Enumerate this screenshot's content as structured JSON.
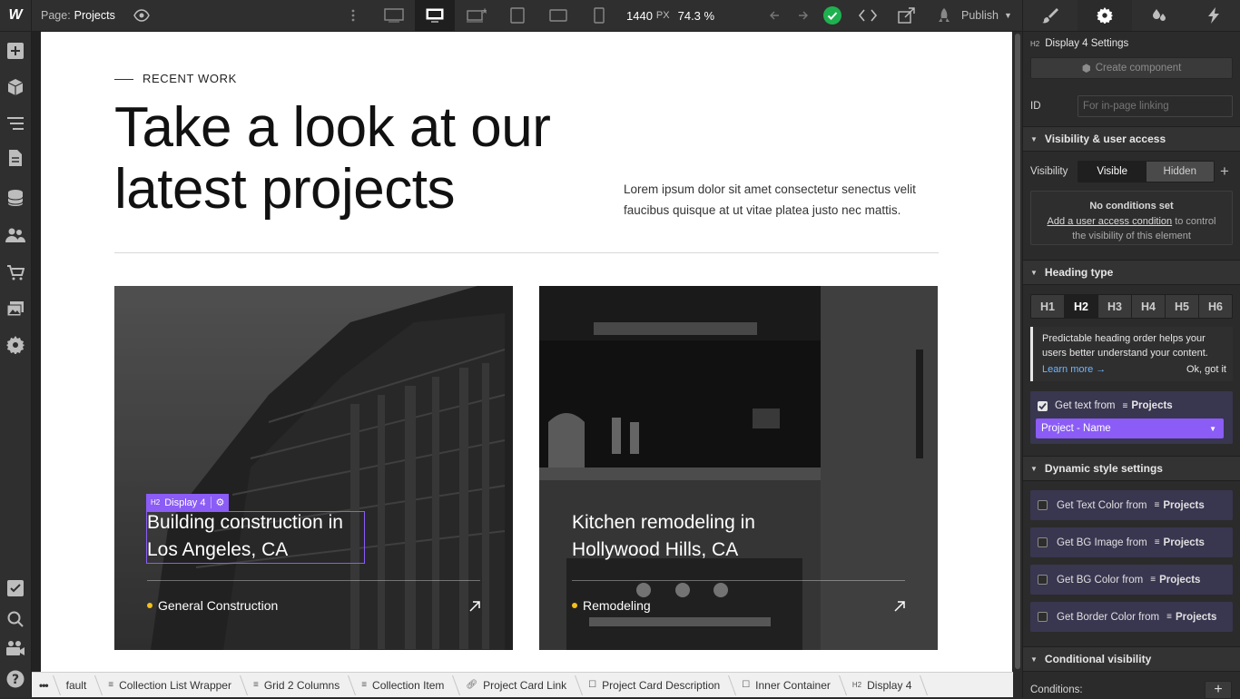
{
  "topbar": {
    "logo": "W",
    "page_label": "Page:",
    "page_name": "Projects",
    "width_value": "1440",
    "width_unit": "PX",
    "zoom": "74.3 %",
    "publish_label": "Publish"
  },
  "canvas": {
    "eyebrow": "RECENT WORK",
    "headline_line1": "Take a look at our",
    "headline_line2": "latest projects",
    "intro_line1": "Lorem ipsum dolor sit amet consectetur senectus velit",
    "intro_line2": "faucibus quisque at ut vitae platea justo nec mattis.",
    "selection_tag": "Display 4",
    "selection_tag_prefix": "H2",
    "cards": [
      {
        "title_line1": "Building construction in",
        "title_line2": "Los Angeles, CA",
        "category": "General Construction"
      },
      {
        "title_line1": "Kitchen remodeling in",
        "title_line2": "Hollywood Hills, CA",
        "category": "Remodeling"
      }
    ]
  },
  "panel": {
    "element_prefix": "H2",
    "element_title": "Display 4 Settings",
    "create_component": "Create component",
    "id_label": "ID",
    "id_placeholder": "For in-page linking",
    "visibility_section": "Visibility & user access",
    "visibility_label": "Visibility",
    "visible_option": "Visible",
    "hidden_option": "Hidden",
    "no_conditions": "No conditions set",
    "access_link": "Add a user access condition",
    "access_rest_1": "to control",
    "access_rest_2": "the visibility of this element",
    "heading_section": "Heading type",
    "headings": [
      "H1",
      "H2",
      "H3",
      "H4",
      "H5",
      "H6"
    ],
    "heading_tip_1": "Predictable heading order helps your",
    "heading_tip_2": "users better understand your content.",
    "learn_more": "Learn more →",
    "ok_got_it": "Ok, got it",
    "get_text_from": "Get text from",
    "collection": "Projects",
    "field_select": "Project - Name",
    "dynamic_section": "Dynamic style settings",
    "dynamic_items": [
      "Get Text Color from",
      "Get BG Image from",
      "Get BG Color from",
      "Get Border Color from"
    ],
    "conditional_section": "Conditional visibility",
    "conditions_label": "Conditions:"
  },
  "breadcrumbs": {
    "more": "•••",
    "items": [
      {
        "label": "fault",
        "icon": "none"
      },
      {
        "label": "Collection List Wrapper",
        "icon": "stack-icon"
      },
      {
        "label": "Grid 2 Columns",
        "icon": "stack-icon"
      },
      {
        "label": "Collection Item",
        "icon": "stack-icon"
      },
      {
        "label": "Project Card Link",
        "icon": "link-icon"
      },
      {
        "label": "Project Card Description",
        "icon": "box-icon"
      },
      {
        "label": "Inner Container",
        "icon": "box-icon"
      },
      {
        "label": "Display 4",
        "icon": "h2-icon",
        "prefix": "H2"
      }
    ]
  },
  "colors": {
    "accent_purple": "#8b5cf6",
    "success_green": "#1fb150",
    "dot_yellow": "#f3c01c"
  }
}
